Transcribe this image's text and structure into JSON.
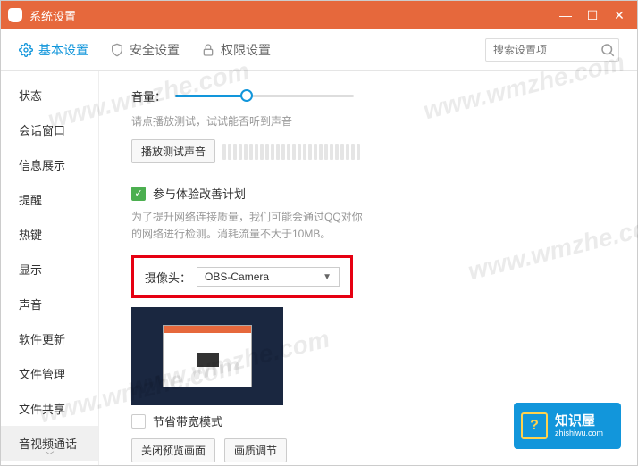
{
  "titlebar": {
    "title": "系统设置"
  },
  "tabs": {
    "basic": "基本设置",
    "security": "安全设置",
    "permission": "权限设置"
  },
  "search": {
    "placeholder": "搜索设置项"
  },
  "sidebar": {
    "items": [
      "状态",
      "会话窗口",
      "信息展示",
      "提醒",
      "热键",
      "显示",
      "声音",
      "软件更新",
      "文件管理",
      "文件共享",
      "音视频通话"
    ]
  },
  "content": {
    "volume_label": "音量：",
    "volume_hint": "请点播放测试，试试能否听到声音",
    "play_test_btn": "播放测试声音",
    "improve_checkbox": "参与体验改善计划",
    "improve_desc": "为了提升网络连接质量，我们可能会通过QQ对你的网络进行检测。消耗流量不大于10MB。",
    "camera_label": "摄像头：",
    "camera_value": "OBS-Camera",
    "bandwidth_checkbox": "节省带宽模式",
    "close_preview_btn": "关闭预览画面",
    "quality_btn": "画质调节"
  },
  "badge": {
    "title": "知识屋",
    "sub": "zhishiwu.com"
  },
  "watermark": "www.wmzhe.com"
}
